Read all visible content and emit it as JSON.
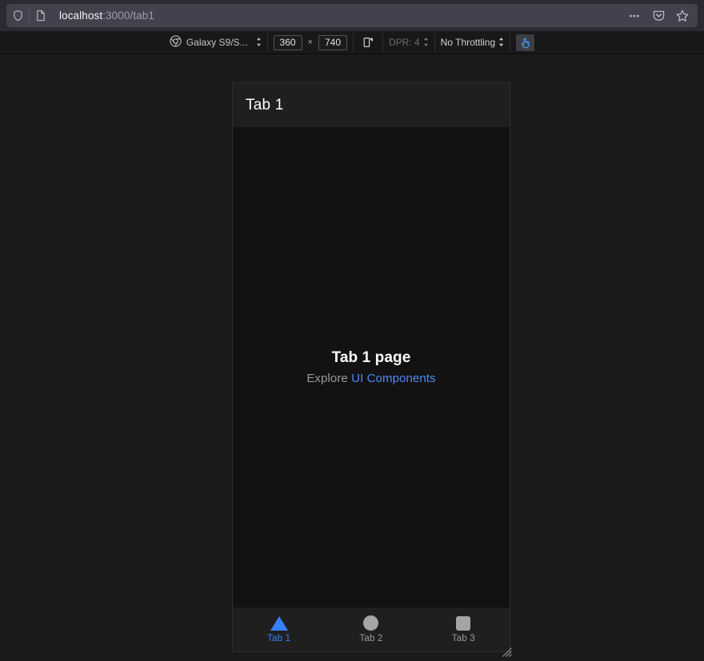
{
  "browser": {
    "url_host": "localhost",
    "url_path": ":3000/tab1",
    "shield_icon": "shield-icon",
    "page_icon": "page-document-icon",
    "meatball_icon": "more-options-icon",
    "pocket_icon": "save-to-pocket-icon",
    "bookmark_icon": "bookmark-star-icon"
  },
  "responsive_toolbar": {
    "device_icon": "chrome-browser-icon",
    "device_name": "Galaxy S9/S...",
    "width_value": "360",
    "height_value": "740",
    "dimension_separator": "×",
    "rotate_icon": "rotate-viewport-icon",
    "dpr_label": "DPR: 4",
    "throttling_label": "No Throttling",
    "touch_icon": "touch-simulation-icon",
    "select_arrows": "▲▼"
  },
  "device_preview": {
    "header": {
      "title": "Tab 1"
    },
    "content": {
      "heading": "Tab 1 page",
      "sub_prefix": "Explore ",
      "link_text": "UI Components"
    },
    "tabbar": {
      "tabs": [
        {
          "label": "Tab 1",
          "icon": "triangle-icon",
          "active": true
        },
        {
          "label": "Tab 2",
          "icon": "circle-icon",
          "active": false
        },
        {
          "label": "Tab 3",
          "icon": "square-icon",
          "active": false
        }
      ]
    },
    "resize_grip_icon": "resize-grip-icon"
  },
  "colors": {
    "accent_blue": "#3880ff",
    "link_blue": "#4a8cf7",
    "app_bg": "#121212",
    "app_surface": "#1f1f1f",
    "page_bg": "#1b1b1b",
    "icon_gray": "#a5a5a5"
  }
}
